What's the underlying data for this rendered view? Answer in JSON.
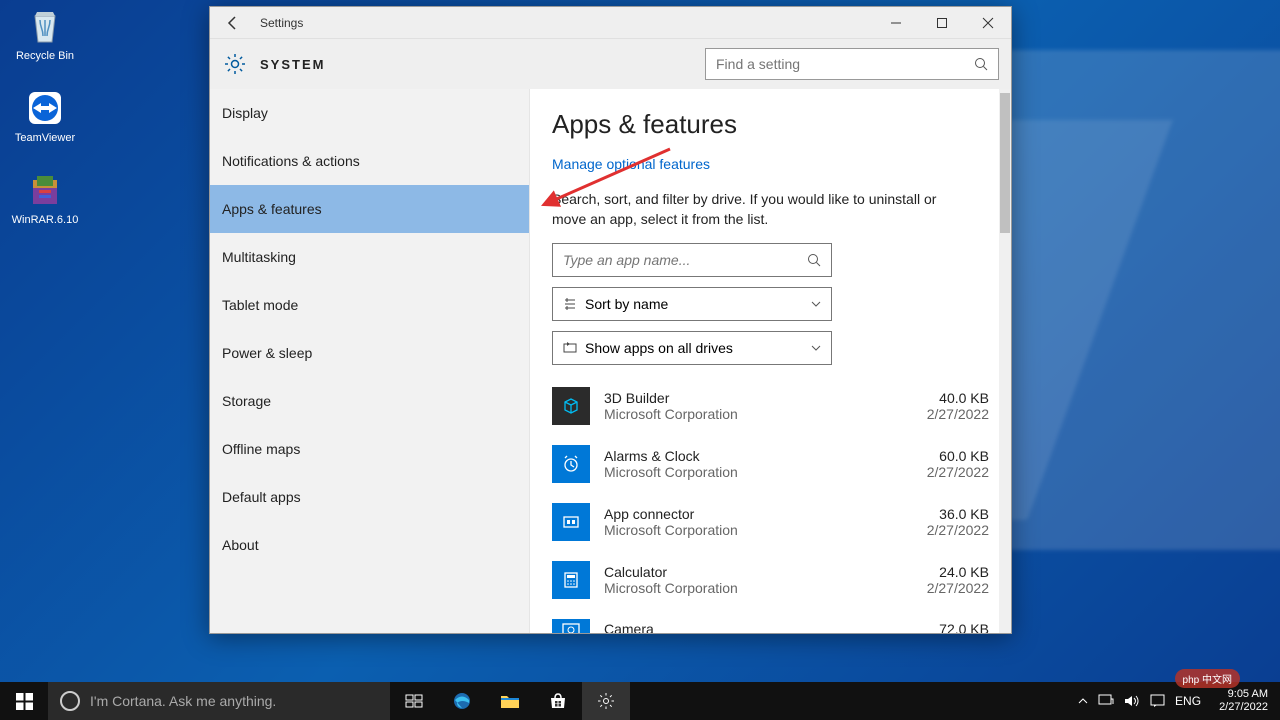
{
  "desktop": {
    "icons": [
      {
        "label": "Recycle Bin",
        "glyph": "recycle"
      },
      {
        "label": "TeamViewer",
        "glyph": "teamviewer"
      },
      {
        "label": "WinRAR.6.10",
        "glyph": "winrar"
      }
    ]
  },
  "window": {
    "title": "Settings",
    "header_label": "SYSTEM",
    "search_placeholder": "Find a setting"
  },
  "sidebar": {
    "items": [
      "Display",
      "Notifications & actions",
      "Apps & features",
      "Multitasking",
      "Tablet mode",
      "Power & sleep",
      "Storage",
      "Offline maps",
      "Default apps",
      "About"
    ],
    "active_index": 2
  },
  "content": {
    "heading": "Apps & features",
    "manage_link": "Manage optional features",
    "description": "Search, sort, and filter by drive. If you would like to uninstall or move an app, select it from the list.",
    "app_search_placeholder": "Type an app name...",
    "sort_label": "Sort by name",
    "filter_label": "Show apps on all drives",
    "apps": [
      {
        "name": "3D Builder",
        "publisher": "Microsoft Corporation",
        "size": "40.0 KB",
        "date": "2/27/2022",
        "icon": "3d"
      },
      {
        "name": "Alarms & Clock",
        "publisher": "Microsoft Corporation",
        "size": "60.0 KB",
        "date": "2/27/2022",
        "icon": "alarm"
      },
      {
        "name": "App connector",
        "publisher": "Microsoft Corporation",
        "size": "36.0 KB",
        "date": "2/27/2022",
        "icon": "connector"
      },
      {
        "name": "Calculator",
        "publisher": "Microsoft Corporation",
        "size": "24.0 KB",
        "date": "2/27/2022",
        "icon": "calc"
      },
      {
        "name": "Camera",
        "publisher": "",
        "size": "72.0 KB",
        "date": "",
        "icon": "camera"
      }
    ]
  },
  "taskbar": {
    "cortana_text": "I'm Cortana. Ask me anything.",
    "lang": "ENG",
    "time": "9:05 AM",
    "date": "2/27/2022"
  },
  "watermark": "php 中文网"
}
